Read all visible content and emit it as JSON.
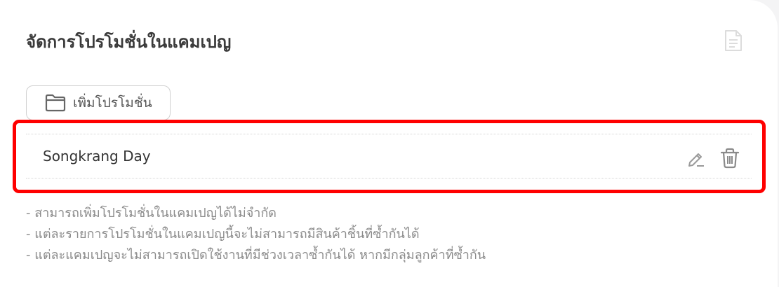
{
  "header": {
    "title": "จัดการโปรโมชั่นในแคมเปญ",
    "doc_icon": "document-icon"
  },
  "add_button": {
    "label": "เพิ่มโปรโมชั่น",
    "icon": "folder-icon"
  },
  "promotions": [
    {
      "name": "Songkrang Day",
      "actions": [
        "edit-icon",
        "trash-icon"
      ]
    }
  ],
  "highlight_color": "#ff0000",
  "notes": [
    "- สามารถเพิ่มโปรโมชั่นในแคมเปญได้ไม่จำกัด",
    "- แต่ละรายการโปรโมชั่นในแคมเปญนี้จะไม่สามารถมีสินค้าชิ้นที่ซ้ำกันได้",
    "- แต่ละแคมเปญจะไม่สามารถเปิดใช้งานที่มีช่วงเวลาซ้ำกันได้ หากมีกลุ่มลูกค้าที่ซ้ำกัน"
  ]
}
